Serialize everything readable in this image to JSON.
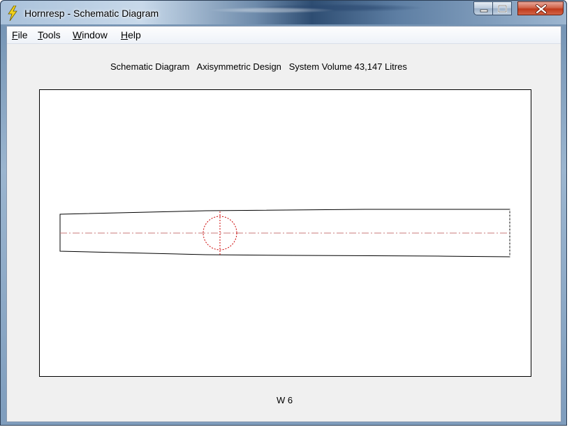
{
  "window": {
    "title": "Hornresp - Schematic Diagram"
  },
  "menu": {
    "items": [
      {
        "underline": "F",
        "rest": "ile"
      },
      {
        "underline": "T",
        "rest": "ools"
      },
      {
        "underline": "W",
        "rest": "indow"
      },
      {
        "underline": "H",
        "rest": "elp"
      }
    ]
  },
  "diagram": {
    "heading": "Schematic Diagram   Axisymmetric Design   System Volume 43,147 Litres",
    "footer_label": "W 6",
    "colors": {
      "outline": "#000000",
      "axis_line": "#c87a7a",
      "driver_marker": "#cc0000"
    }
  },
  "icons": {
    "app": "lightning-icon",
    "minimize": "minimize-icon",
    "maximize": "maximize-icon",
    "close": "close-icon"
  }
}
